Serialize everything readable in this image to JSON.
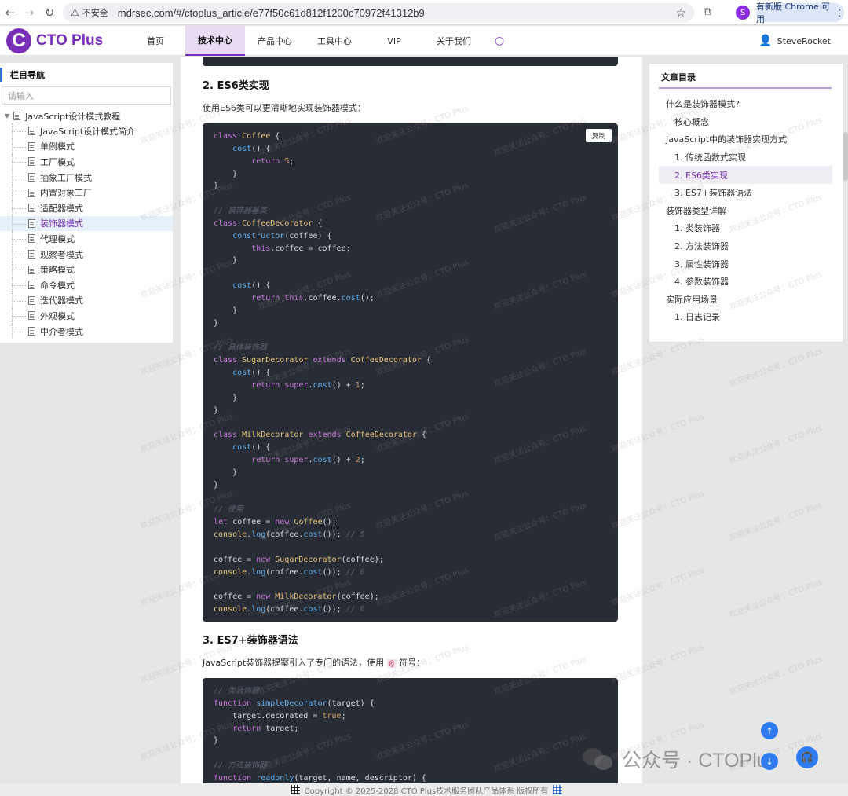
{
  "browser": {
    "insecure_label": "不安全",
    "url": "mdrsec.com/#/ctoplus_article/e77f50c61d812f1200c70972f41312b9",
    "profile_letter": "S",
    "update_label": "有新版 Chrome 可用"
  },
  "header": {
    "logo_letter": "C",
    "logo_text": "CTO Plus",
    "menu": [
      {
        "label": "首页"
      },
      {
        "label": "技术中心"
      },
      {
        "label": "产品中心"
      },
      {
        "label": "工具中心"
      },
      {
        "label": "VIP"
      },
      {
        "label": "关于我们"
      }
    ],
    "active_index": 1,
    "user_name": "SteveRocket"
  },
  "sidebar": {
    "title": "栏目导航",
    "search_placeholder": "请输入",
    "root": "JavaScript设计模式教程",
    "items": [
      {
        "label": "JavaScript设计模式简介"
      },
      {
        "label": "单例模式"
      },
      {
        "label": "工厂模式"
      },
      {
        "label": "抽象工厂模式"
      },
      {
        "label": "内置对象工厂"
      },
      {
        "label": "适配器模式"
      },
      {
        "label": "装饰器模式"
      },
      {
        "label": "代理模式"
      },
      {
        "label": "观察者模式"
      },
      {
        "label": "策略模式"
      },
      {
        "label": "命令模式"
      },
      {
        "label": "迭代器模式"
      },
      {
        "label": "外观模式"
      },
      {
        "label": "中介者模式"
      }
    ],
    "active_index": 6
  },
  "article": {
    "section2_title": "2. ES6类实现",
    "section2_desc": "使用ES6类可以更清晰地实现装饰器模式：",
    "copy_label": "复制",
    "section3_title": "3. ES7+装饰器语法",
    "section3_desc_before": "JavaScript装饰器提案引入了专门的语法，使用",
    "section3_symbol": "@",
    "section3_desc_after": "符号："
  },
  "toc": {
    "title": "文章目录",
    "items": [
      {
        "label": "什么是装饰器模式?",
        "level": 1
      },
      {
        "label": "核心概念",
        "level": 2
      },
      {
        "label": "JavaScript中的装饰器实现方式",
        "level": 1
      },
      {
        "label": "1. 传统函数式实现",
        "level": 2
      },
      {
        "label": "2. ES6类实现",
        "level": 2
      },
      {
        "label": "3. ES7+装饰器语法",
        "level": 2
      },
      {
        "label": "装饰器类型详解",
        "level": 1
      },
      {
        "label": "1. 类装饰器",
        "level": 2
      },
      {
        "label": "2. 方法装饰器",
        "level": 2
      },
      {
        "label": "3. 属性装饰器",
        "level": 2
      },
      {
        "label": "4. 参数装饰器",
        "level": 2
      },
      {
        "label": "实际应用场景",
        "level": 1
      },
      {
        "label": "1. 日志记录",
        "level": 2
      }
    ],
    "active_index": 4
  },
  "watermark": "欢迎关注公众号：CTO Plus",
  "overlay": {
    "text": "公众号 · CTOPlus"
  },
  "footer": {
    "copyright": "Copyright © 2025-2028 CTO Plus技术服务团队产品体系 版权所有"
  }
}
